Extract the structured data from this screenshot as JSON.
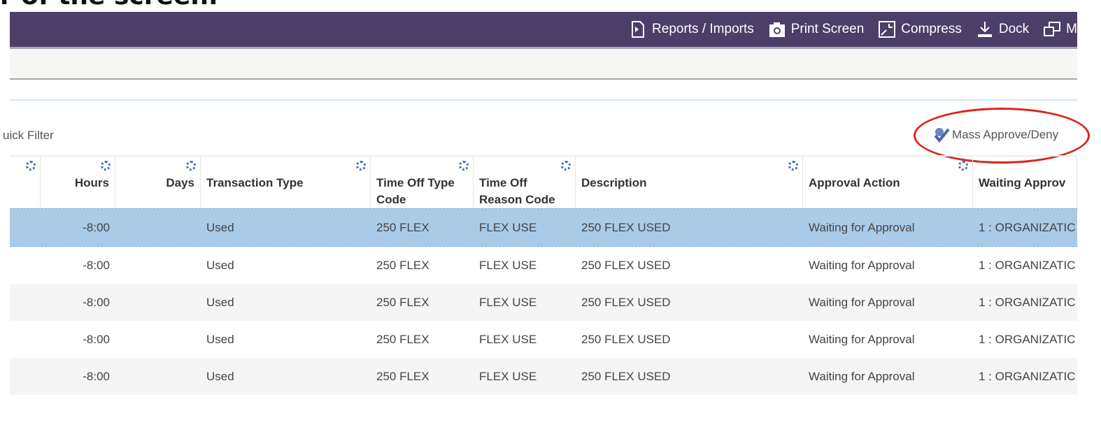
{
  "caption": "r of the screen.",
  "toolbar": {
    "items": [
      {
        "label": "Reports / Imports",
        "icon": "report-icon"
      },
      {
        "label": "Print Screen",
        "icon": "camera-icon"
      },
      {
        "label": "Compress",
        "icon": "compress-icon"
      },
      {
        "label": "Dock",
        "icon": "dock-icon"
      },
      {
        "label": "M",
        "icon": "window-icon"
      }
    ]
  },
  "quick_filter": "uick Filter",
  "mass_approve": "Mass Approve/Deny",
  "annotation_color": "#d9261c",
  "columns": [
    "",
    "Hours",
    "Days",
    "Transaction Type",
    "Time Off Type Code",
    "Time Off Reason Code",
    "Description",
    "Approval Action",
    "Waiting Approv"
  ],
  "rows": [
    [
      "",
      "-8:00",
      "",
      "Used",
      "250 FLEX",
      "FLEX USE",
      "250 FLEX USED",
      "Waiting for Approval",
      "1 : ORGANIZATIC"
    ],
    [
      "",
      "-8:00",
      "",
      "Used",
      "250 FLEX",
      "FLEX USE",
      "250 FLEX USED",
      "Waiting for Approval",
      "1 : ORGANIZATIC"
    ],
    [
      "",
      "-8:00",
      "",
      "Used",
      "250 FLEX",
      "FLEX USE",
      "250 FLEX USED",
      "Waiting for Approval",
      "1 : ORGANIZATIC"
    ],
    [
      "",
      "-8:00",
      "",
      "Used",
      "250 FLEX",
      "FLEX USE",
      "250 FLEX USED",
      "Waiting for Approval",
      "1 : ORGANIZATIC"
    ],
    [
      "",
      "-8:00",
      "",
      "Used",
      "250 FLEX",
      "FLEX USE",
      "250 FLEX USED",
      "Waiting for Approval",
      "1 : ORGANIZATIC"
    ]
  ]
}
